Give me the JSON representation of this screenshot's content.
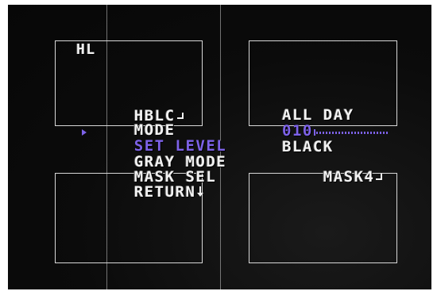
{
  "osd": {
    "title": "HL",
    "colors": {
      "text": "#f2f2f2",
      "selected": "#7d62e8",
      "background": "#0b0b0b",
      "mask_border": "#d8d8d8"
    },
    "menu": [
      {
        "label": "HBLC",
        "value": "",
        "icon": "enter-icon",
        "selected": false
      },
      {
        "label": "MODE",
        "value": "ALL DAY",
        "icon": "",
        "selected": false
      },
      {
        "label": "SET LEVEL",
        "value": "010",
        "icon": "",
        "selected": true,
        "level_fraction": 0.1
      },
      {
        "label": "GRAY MODE",
        "value": "BLACK",
        "icon": "",
        "selected": false
      },
      {
        "label": "MASK SEL",
        "value": "MASK4",
        "icon": "enter-icon",
        "selected": false
      },
      {
        "label": "RETURN",
        "value": "",
        "icon": "down-icon",
        "selected": false
      }
    ]
  }
}
